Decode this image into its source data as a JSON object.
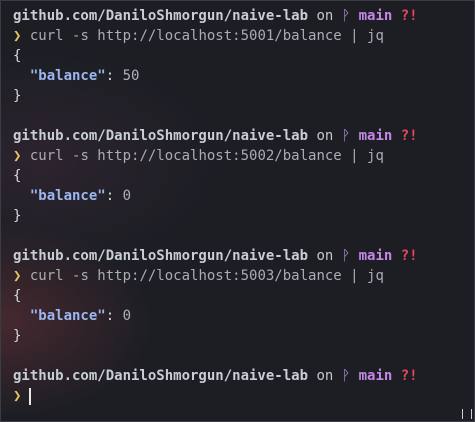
{
  "prompt_glyph": "❯",
  "blocks": [
    {
      "path": "github.com/DaniloShmorgun/naive-lab",
      "on": "on",
      "branch_icon": "ᚹ",
      "branch": "main",
      "status": "?!",
      "command": "curl -s http://localhost:5001/balance | jq",
      "open": "{",
      "key": "\"balance\"",
      "colon": ": ",
      "value": "50",
      "close": "}"
    },
    {
      "path": "github.com/DaniloShmorgun/naive-lab",
      "on": "on",
      "branch_icon": "ᚹ",
      "branch": "main",
      "status": "?!",
      "command": "curl -s http://localhost:5002/balance | jq",
      "open": "{",
      "key": "\"balance\"",
      "colon": ": ",
      "value": "0",
      "close": "}"
    },
    {
      "path": "github.com/DaniloShmorgun/naive-lab",
      "on": "on",
      "branch_icon": "ᚹ",
      "branch": "main",
      "status": "?!",
      "command": "curl -s http://localhost:5003/balance | jq",
      "open": "{",
      "key": "\"balance\"",
      "colon": ": ",
      "value": "0",
      "close": "}"
    }
  ],
  "final": {
    "path": "github.com/DaniloShmorgun/naive-lab",
    "on": "on",
    "branch_icon": "ᚹ",
    "branch": "main",
    "status": "?!"
  }
}
